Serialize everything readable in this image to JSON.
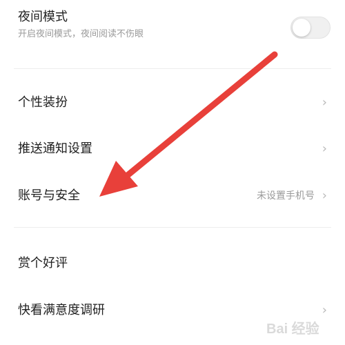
{
  "night_mode": {
    "title": "夜间模式",
    "subtitle": "开启夜间模式，夜间阅读不伤眼",
    "enabled": false
  },
  "items": [
    {
      "label": "个性装扮",
      "chevron": "›"
    },
    {
      "label": "推送通知设置",
      "chevron": "›"
    },
    {
      "label": "账号与安全",
      "value": "未设置手机号",
      "chevron": "›"
    },
    {
      "label": "赏个好评"
    },
    {
      "label": "快看满意度调研",
      "chevron": "›"
    }
  ],
  "colors": {
    "annotation_arrow": "#e8403a",
    "text_primary": "#1f1f1f",
    "text_secondary": "#9a9a9a"
  },
  "watermark": {
    "text": "Bai 经验"
  }
}
